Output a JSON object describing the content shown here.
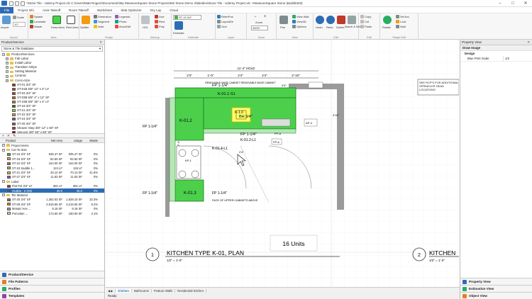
{
  "titlebar": {
    "title": "*Stone Tile - Udemy Project.vlc C:\\Users\\Matt Rogers\\Documents\\My MeasureSquare Stone Projects\\M2 Stone Demo Slideidex\\Stone Tile - Udemy Project.vlc +MeasureSquare Stone (Build9403)"
  },
  "menu": [
    "File",
    "Project Info",
    "Area Takeoff",
    "Room Takeoff",
    "Worksheet",
    "Slab Optimizer",
    "Dry Lay",
    "Cloud"
  ],
  "ribbon": {
    "import": {
      "import": "Import",
      "scale": "Scale",
      "scale_val": "1/2",
      "group": "Import"
    },
    "area": {
      "splash": "Splash",
      "laminate": "Laminate",
      "waste": "Waste",
      "draw_area": "Draw Area",
      "rect_area": "Rect Area",
      "group": "Area"
    },
    "shape": {
      "splitter": "Splitter",
      "dimension": "Dimension",
      "segment": "Segment",
      "note": "Note",
      "legends": "Legends",
      "photo": "Photo",
      "annotate": "AnnoEdit",
      "group": "Shape"
    },
    "markup": {
      "hol": "HOL",
      "line": "Line",
      "rect": "Rect",
      "poly": "Poly",
      "group": "Markup"
    },
    "estimate": {
      "product": "ST-15 3/4\"",
      "estimate": "Estimate",
      "group": "Estimate"
    },
    "layer": {
      "refer_pos": "ReferPos",
      "layout": "LayoutDe",
      "grid": "Grid",
      "group": "Layer"
    },
    "zoom": {
      "zoom": "Zoom",
      "zoom_val": "450%",
      "group": "Zoom"
    },
    "view": {
      "pan": "Pan",
      "view_wall": "View Wall",
      "view3d": "View3D",
      "options": "Options",
      "group": "View"
    },
    "edit": {
      "undo": "Undo",
      "redo": "Redo",
      "delete": "Delete",
      "search": "Search & Select",
      "group": "Edit"
    },
    "clip": {
      "copy": "Copy",
      "cut": "Cut",
      "paste": "Paste",
      "rotate": "Rotate",
      "group": "Edit"
    },
    "shape_edit": {
      "set_arc": "Set Arc",
      "lock": "Lock",
      "wall": "Wall",
      "group": "Shape Edit"
    }
  },
  "left": {
    "header": "Product/Service",
    "database": "Stone & Tile Database",
    "tree": [
      {
        "type": "root",
        "label": "Product/Services"
      },
      {
        "type": "folder",
        "label": "Fab Labor"
      },
      {
        "type": "folder",
        "label": "Install Labor"
      },
      {
        "type": "folder",
        "label": "Transition Strips"
      },
      {
        "type": "folder",
        "label": "Setting Material"
      },
      {
        "type": "folder",
        "label": "Ceramic"
      },
      {
        "type": "folder",
        "label": "Cut-to-Size"
      },
      {
        "type": "item",
        "label": "ST-01  3/4\" SF",
        "color": "#8b3a1e"
      },
      {
        "type": "item",
        "label": "ST-01B  5/8\" 12\" x 4\" LF",
        "color": "#b7472a"
      },
      {
        "type": "item",
        "label": "ST-03  3/4\" SF",
        "color": "#c0392b"
      },
      {
        "type": "item",
        "label": "ST-03B  5/8\" 4\" x 12\" SF",
        "color": "#d35d3a"
      },
      {
        "type": "item",
        "label": "ST-15B  5/8\" 36\" x 4\" LF",
        "color": "#b8860b"
      },
      {
        "type": "item",
        "label": "ST-18  3/4\" SF",
        "color": "#3c6e2f"
      },
      {
        "type": "item",
        "label": "ST-21  3/4\" SF",
        "color": "#9acd32"
      },
      {
        "type": "item",
        "label": "ST-22  3/4\" SF",
        "color": "#d4a017"
      },
      {
        "type": "item",
        "label": "ST-24  3/4\" SF",
        "color": "#6a5acd"
      },
      {
        "type": "item",
        "label": "ST-25  3/4\" SF",
        "color": "#a0522d"
      },
      {
        "type": "item",
        "label": "Shower Step  3/8\" 12\" x 60\" SF",
        "color": "#b03060"
      },
      {
        "type": "item",
        "label": "Vanocet  3/8\" 60\" x 60\" SF",
        "color": "#8b0000"
      }
    ],
    "table_header": [
      "Product",
      "Net Area",
      "Usage",
      "Waste"
    ],
    "table": [
      {
        "kind": "group",
        "name": "Project Items"
      },
      {
        "kind": "group",
        "name": "Cut-To-Size"
      },
      {
        "kind": "row",
        "name": "ST-15  3/4\" SF",
        "color": "#4caf50",
        "net": "935.47 SF",
        "usage": "935.47 SF",
        "waste": "0%"
      },
      {
        "kind": "row",
        "name": "ST-18  3/4\" SF",
        "color": "#e8a33c",
        "net": "82.50 SF",
        "usage": "82.50 SF",
        "waste": "0%"
      },
      {
        "kind": "row",
        "name": "ST-22  3/4\" SF",
        "color": "#d9534f",
        "net": "154.00 SF",
        "usage": "154.00 SF",
        "waste": "0%"
      },
      {
        "kind": "row",
        "name": "ST-18  Saddle  1...",
        "color": "#8bc34a",
        "net": "124 LF",
        "usage": "126 LF",
        "waste": "0%"
      },
      {
        "kind": "row",
        "name": "ST-21  3/4\" SF",
        "color": "#f4b400",
        "net": "33.12 SF",
        "usage": "70.13 SF",
        "waste": "41.6%"
      },
      {
        "kind": "row",
        "name": "ST-27  3/4\" SF",
        "color": "#7e57c2",
        "net": "11.83 SF",
        "usage": "11.83 SF",
        "waste": "0%"
      },
      {
        "kind": "group",
        "name": "Labor"
      },
      {
        "kind": "row",
        "name": "Flat Pol  3/4\" LF",
        "color": "#c62828",
        "net": "681 LF",
        "usage": "681 LF",
        "waste": "0%"
      },
      {
        "kind": "row",
        "name": "Outline - K-002",
        "color": "#1565c0",
        "net": "30.0",
        "usage": "30.0",
        "waste": "0%",
        "selected": true
      },
      {
        "kind": "group",
        "name": "Tile Material"
      },
      {
        "kind": "row",
        "name": "ST-20  3/4\" SF",
        "color": "#8d6e63",
        "net": "1,362.03 SF",
        "usage": "1,828.10 SF",
        "waste": "32.3%"
      },
      {
        "kind": "row",
        "name": "ST-09  3/4\" SF",
        "color": "#f57c00",
        "net": "2,918.65 SF",
        "usage": "3,216.50 SF",
        "waste": "9.2%"
      },
      {
        "kind": "row",
        "name": "Mosaic Hex  ...",
        "color": "#90a4ae",
        "net": "8.16 SF",
        "usage": "8.16 SF",
        "waste": "0%"
      },
      {
        "kind": "row",
        "name": "Porcelain  ...",
        "color": "#ffcc80",
        "net": "174.50 SF",
        "usage": "180.00 SF",
        "waste": "3.1%"
      }
    ],
    "nav": [
      "Product/Service",
      "File Patterns",
      "Profiles",
      "Templates"
    ]
  },
  "right": {
    "header": "Property View",
    "section": "Draw Image",
    "subsection": "Design",
    "prop_label": "Blue Print Scale",
    "prop_value": "1/2",
    "nav": [
      "Property View",
      "Estimation View",
      "Object View"
    ]
  },
  "drawing": {
    "top_dim": "11'-4\" HOLD",
    "dims": [
      "2'3\"",
      "1'-0\"",
      "2'4\"",
      "2'4\"",
      "2'-10\"",
      "4'3\""
    ],
    "banner": "REMOVABLE BASE CABINET REMOVABLE BASE CABINET",
    "labels": {
      "fp1": "FP 1-1/4\"",
      "k01_1": "K-01.1-S1",
      "k01_2": "K-01.2",
      "fp2": "FP 1-1/4\"",
      "k01_2l1": "K-01.2-L1",
      "k01_3": "K-01.3",
      "k01_4": "K-01.4-L1",
      "face_note": "FACE OF UPPER CABINETS ABOVE",
      "bh": "BH 3/4\"",
      "kp": "K-1.0",
      "ap4": "AP-4",
      "fp6": "FP-6",
      "fpa": "FP-A",
      "fp_left1": "FP 1-1/4\"",
      "fp_left2": "FP 1-1/4\"",
      "kp1": "KP-1",
      "ref_note": "SEE RCP'S FOR ADDITIONAL SPRINKLER HEAD LOCATIONS",
      "cab_dim": "2'4\"",
      "left_dim": "7'-6 HOLD",
      "right_dim": "3'10\"",
      "overlay_box": "K-1.0"
    },
    "units": "16 Units",
    "plan_num": "1",
    "plan_title": "KITCHEN TYPE K-01, PLAN",
    "plan_scale": "1/2\" = 1'-0\"",
    "plan2_num": "2",
    "plan2_title": "KITCHEN",
    "plan2_scale": "1/2\" = 1'-0\""
  },
  "tabs": [
    "Kitchen",
    "Bathrooms",
    "Feature Walls",
    "Residential Kitchen"
  ],
  "status": "Ready",
  "colors": {
    "accent": "#2d6cb5",
    "counter": "#4cd04c",
    "counter_stroke": "#1a7a1a",
    "wall": "#9a9a9a",
    "highlight": "#ffff66"
  }
}
